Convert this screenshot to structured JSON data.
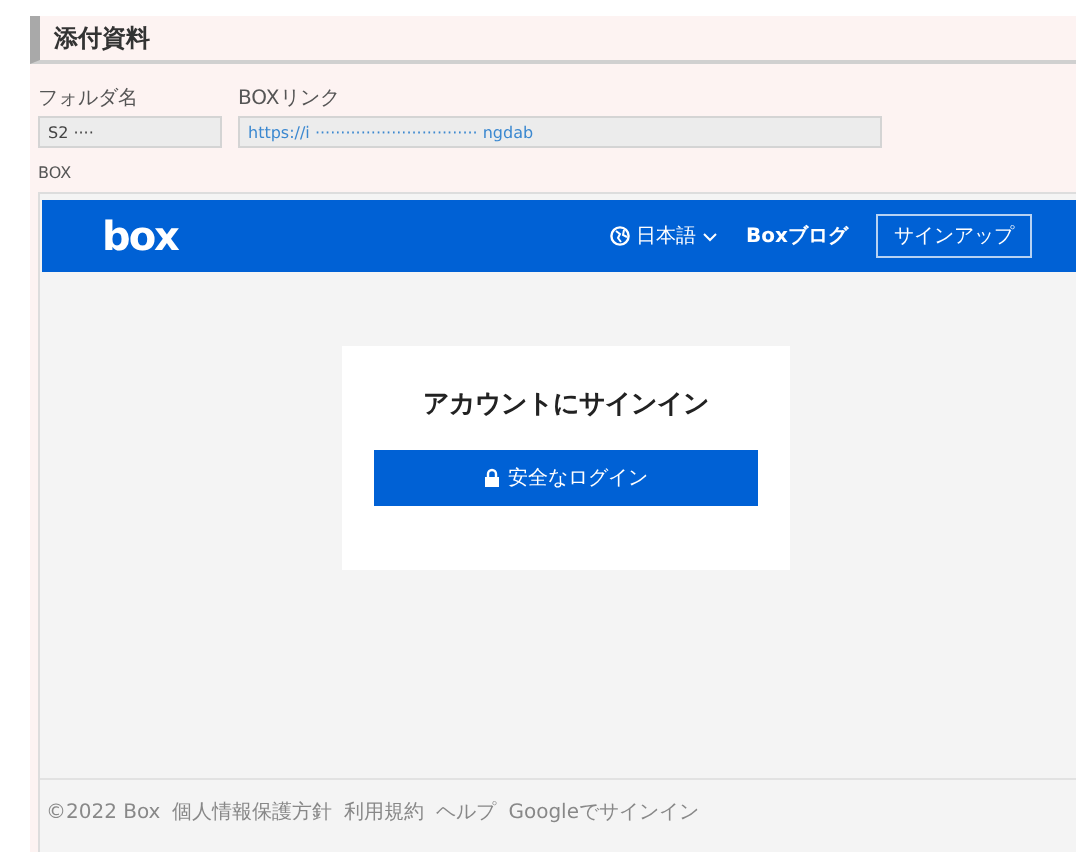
{
  "section": {
    "title": "添付資料"
  },
  "fields": [
    {
      "label": "フォルダ名",
      "value": "S2 ····"
    },
    {
      "label": "BOXリンク",
      "value": "https://i   ································   ngdab"
    }
  ],
  "embed": {
    "label": "BOX",
    "logo": "box",
    "nav": {
      "language": "日本語",
      "blog": "Boxブログ",
      "signup": "サインアップ"
    },
    "card": {
      "title": "アカウントにサインイン",
      "button": "安全なログイン"
    },
    "footer": [
      "©2022 Box",
      "個人情報保護方針",
      "利用規約",
      "ヘルプ",
      "Googleでサインイン"
    ]
  }
}
